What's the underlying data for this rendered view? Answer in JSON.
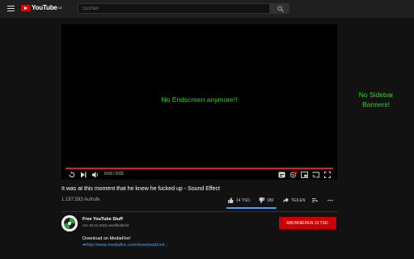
{
  "header": {
    "logo_text": "YouTube",
    "logo_sup": "DE",
    "search_placeholder": "Suchen"
  },
  "player": {
    "overlay_message": "No Endscreen anymore!!",
    "time": "0:03 / 0:03",
    "progress": 1.0,
    "progress_color": "#e21b1b"
  },
  "sidebar": {
    "message": "No Sidebar Banners!",
    "color": "#1bdf1b"
  },
  "video": {
    "title": "It was at this moment that he knew he fucked up - Sound Effect",
    "views": "1.197.593 Aufrufe",
    "likes": "14 TSD.",
    "dislikes": "180",
    "share_label": "TEILEN",
    "like_ratio": 0.99
  },
  "channel": {
    "name": "Free YouTube Stuff",
    "published": "Am 19.12.2015 veröffentlicht",
    "subscribe_label": "ABONNIEREN",
    "subscriber_count": "13 TSD."
  },
  "description": {
    "line1": "Download on MediaFire!",
    "link": "http://www.mediafire.com/download/cs4..."
  },
  "colors": {
    "accent": "#cc0000",
    "link": "#3ea6ff",
    "background": "#121212"
  }
}
